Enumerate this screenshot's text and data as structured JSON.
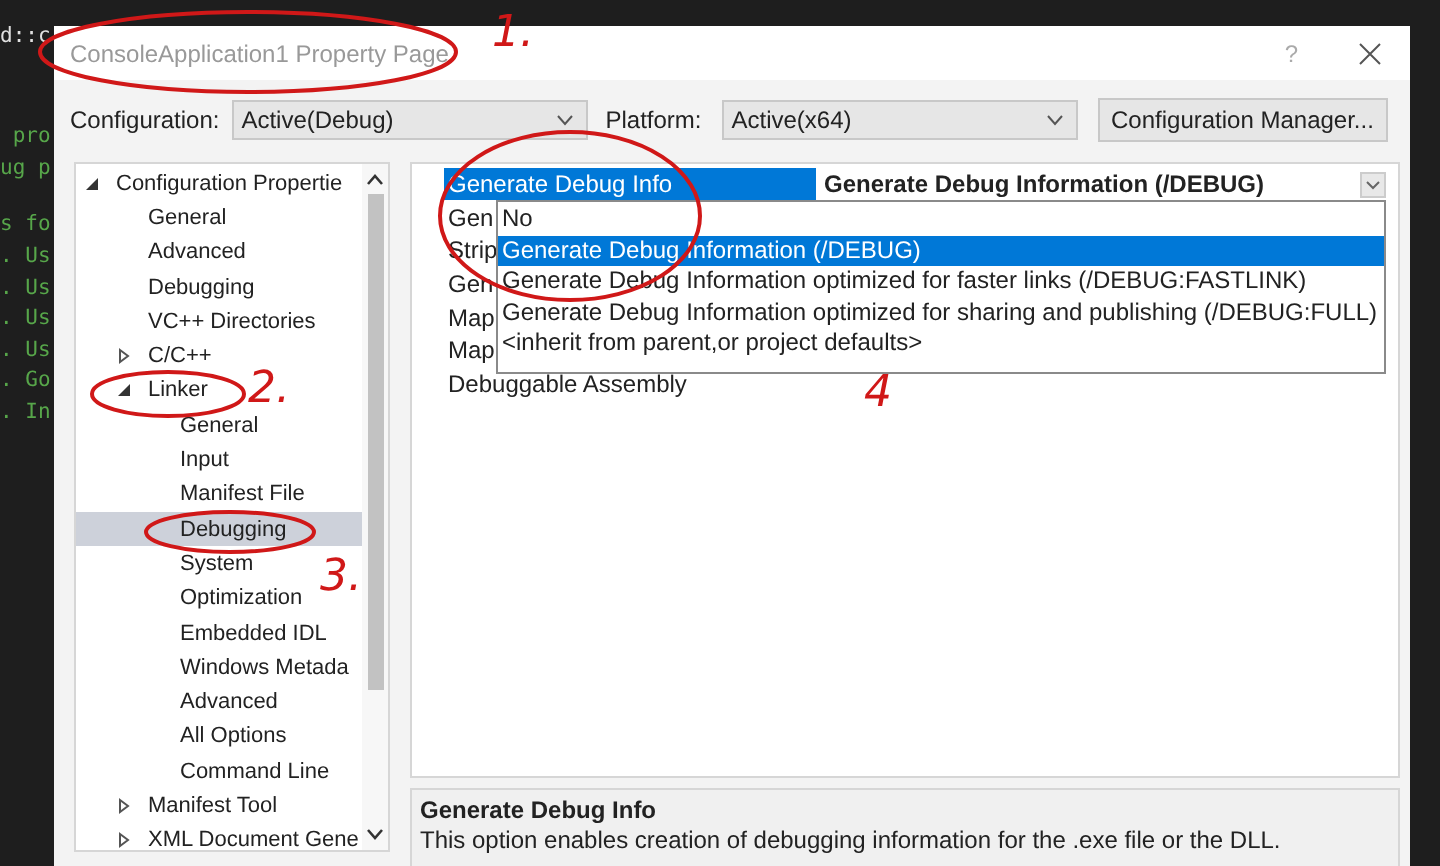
{
  "editor_lines": [
    {
      "text": "d::c",
      "color": "#e0e0e0"
    },
    {
      "text": " pro",
      "color": "#57a64a"
    },
    {
      "text": "ug p",
      "color": "#57a64a"
    },
    {
      "text": "s fo",
      "color": "#57a64a"
    },
    {
      "text": ". Us",
      "color": "#57a64a"
    },
    {
      "text": ". Us",
      "color": "#57a64a"
    },
    {
      "text": ". Us",
      "color": "#57a64a"
    },
    {
      "text": ". Us",
      "color": "#57a64a"
    },
    {
      "text": ". Go",
      "color": "#57a64a"
    },
    {
      "text": ". In",
      "color": "#57a64a"
    }
  ],
  "window": {
    "title": "ConsoleApplication1 Property Page",
    "help": "?"
  },
  "configuration": {
    "label": "Configuration:",
    "value": "Active(Debug)"
  },
  "platform": {
    "label": "Platform:",
    "value": "Active(x64)"
  },
  "config_manager_button": "Configuration Manager...",
  "tree": [
    {
      "label": "Configuration Propertie",
      "expanded": true,
      "selected": false,
      "children": [
        {
          "label": "General",
          "selected": false
        },
        {
          "label": "Advanced",
          "selected": false
        },
        {
          "label": "Debugging",
          "selected": false
        },
        {
          "label": "VC++ Directories",
          "selected": false
        },
        {
          "label": "C/C++",
          "expanded": false,
          "selected": false
        },
        {
          "label": "Linker",
          "expanded": true,
          "selected": false,
          "children": [
            {
              "label": "General",
              "selected": false
            },
            {
              "label": "Input",
              "selected": false
            },
            {
              "label": "Manifest File",
              "selected": false
            },
            {
              "label": "Debugging",
              "selected": true
            },
            {
              "label": "System",
              "selected": false
            },
            {
              "label": "Optimization",
              "selected": false
            },
            {
              "label": "Embedded IDL",
              "selected": false
            },
            {
              "label": "Windows Metada",
              "selected": false
            },
            {
              "label": "Advanced",
              "selected": false
            },
            {
              "label": "All Options",
              "selected": false
            },
            {
              "label": "Command Line",
              "selected": false
            }
          ]
        },
        {
          "label": "Manifest Tool",
          "expanded": false,
          "selected": false
        },
        {
          "label": "XML Document Gene",
          "expanded": false,
          "selected": false
        }
      ]
    }
  ],
  "properties": [
    {
      "name": "Generate Debug Info",
      "value": "Generate Debug Information (/DEBUG)",
      "selected": true
    },
    {
      "name": "Gen",
      "selected": false
    },
    {
      "name": "Strip",
      "selected": false
    },
    {
      "name": "Gen",
      "selected": false
    },
    {
      "name": "Map",
      "selected": false
    },
    {
      "name": "Map",
      "selected": false
    },
    {
      "name": "Debuggable Assembly",
      "selected": false
    }
  ],
  "dropdown_options": [
    {
      "label": "No",
      "selected": false
    },
    {
      "label": "Generate Debug Information (/DEBUG)",
      "selected": true
    },
    {
      "label": "Generate Debug Information optimized for faster links (/DEBUG:FASTLINK)",
      "selected": false
    },
    {
      "label": "Generate Debug Information optimized for sharing and publishing (/DEBUG:FULL)",
      "selected": false
    },
    {
      "label": "<inherit from parent,or project defaults>",
      "selected": false
    }
  ],
  "description": {
    "title": "Generate Debug Info",
    "text": "This option enables creation of debugging information for the .exe file or the DLL."
  },
  "annotations": [
    {
      "label": "1."
    },
    {
      "label": "4"
    },
    {
      "label": "2."
    },
    {
      "label": "3."
    }
  ]
}
